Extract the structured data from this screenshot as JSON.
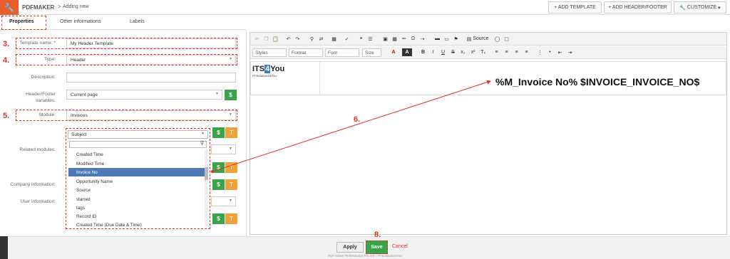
{
  "header": {
    "app_name": "PDFMAKER",
    "separator": ">",
    "page": "Adding new",
    "buttons": {
      "add_template": "+ ADD TEMPLATE",
      "add_header_footer": "+ ADD HEADER/FOOTER",
      "customize": "CUSTOMIZE"
    }
  },
  "tabs": [
    "Properties",
    "Other informations",
    "Labels"
  ],
  "form": {
    "template_name_label": "Template name: *",
    "template_name_value": "My Header Template",
    "type_label": "Type:",
    "type_value": "Header",
    "description_label": "Description:",
    "hf_vars_label": "Header/Footer variables:",
    "hf_vars_value": "Current page",
    "module_label": "Module:",
    "module_value": "Invoices",
    "related_label": "Related modules:",
    "company_label": "Company information:",
    "user_label": "User information:"
  },
  "dropdown": {
    "selected": "Subject",
    "items": [
      "Created Time",
      "Modified Time",
      "Invoice No",
      "Opportunity Name",
      "Source",
      "starred",
      "tags",
      "Record ID",
      "Created Time (Due Date & Time)"
    ],
    "highlighted": "Invoice No"
  },
  "buttons": {
    "dollar": "$",
    "text": "T"
  },
  "steps": {
    "s3": "3.",
    "s4": "4.",
    "s5": "5.",
    "s6": "6.",
    "s8": "8."
  },
  "editor": {
    "source_label": "Source",
    "combos": [
      "Styles",
      "Format",
      "Font",
      "Size"
    ],
    "logo_text_a": "ITS",
    "logo_text_b": "4",
    "logo_text_c": "You",
    "logo_sub": "IT-Solutions4You",
    "variable_text": "%M_Invoice No% $INVOICE_INVOICE_NO$"
  },
  "footer": {
    "apply": "Apply",
    "save": "Save",
    "cancel": "Cancel",
    "copyright": "PDF Maker Professional 700.4.0 :: IT-Solutions4You"
  },
  "colors": {
    "accent": "#e95c2b",
    "green": "#3aa44b",
    "orange": "#f0a13a",
    "highlight": "#4f79b5",
    "annotation": "#dd3322"
  }
}
